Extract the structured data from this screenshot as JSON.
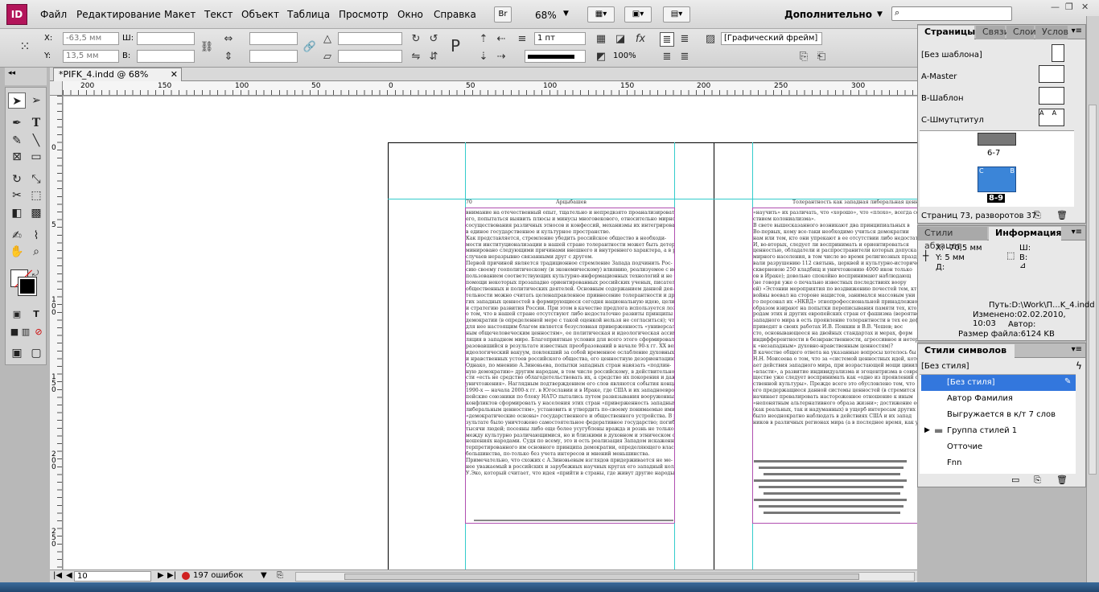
{
  "app": {
    "logo": "ID",
    "menu": [
      "Файл",
      "Редактирование",
      "Макет",
      "Текст",
      "Объект",
      "Таблица",
      "Просмотр",
      "Окно",
      "Справка"
    ],
    "bridge_button": "Br",
    "zoom": "68%",
    "workspace": "Дополнительно"
  },
  "control": {
    "x_label": "X:",
    "x_value": "-63,5 мм",
    "y_label": "Y:",
    "y_value": "13,5 мм",
    "w_label": "Ш:",
    "h_label": "В:",
    "stroke_weight": "1 пт",
    "opacity": "100%",
    "object_style": "[Графический фрейм]"
  },
  "document": {
    "tab_title": "*PIFK_4.indd @ 68%",
    "ruler_h": [
      "200",
      "150",
      "100",
      "50",
      "0",
      "50",
      "100",
      "150",
      "200",
      "250",
      "300"
    ],
    "ruler_v": [
      "0",
      "5",
      "1\n0\n0",
      "1\n5\n0",
      "2\n0\n0",
      "2\n5\n0"
    ],
    "left_header_num": "70",
    "left_header_title": "Арцыбашев",
    "right_header_title": "Толерантность как западная либеральная ценность"
  },
  "status": {
    "page": "10",
    "errors": "197 ошибок"
  },
  "pages_panel": {
    "tabs": [
      "Страницы",
      "Связи",
      "Слои",
      "Услов"
    ],
    "masters": [
      "[Без шаблона]",
      "A-Master",
      "B-Шаблон",
      "C-Шмутцтитул"
    ],
    "spread_a": "6-7",
    "spread_b": "8-9",
    "footer": "Страниц 73, разворотов 37"
  },
  "info_panel": {
    "tabs": [
      "Стили абзацев",
      "Информация"
    ],
    "x": "X: -70,5 мм",
    "y": "Y: 5 мм",
    "d": "Д:",
    "w": "Ш:",
    "h": "В:",
    "path": "Путь:D:\\Work\\П...K_4.indd",
    "modified": "Изменено:02.02.2010, 10:03",
    "author": "Автор:",
    "size": "Размер файла:6124 KB"
  },
  "char_styles": {
    "title": "Стили символов",
    "current": "[Без стиля]",
    "items": [
      "[Без стиля]",
      "Автор Фамилия",
      "Выгружается в к/т 7 слов",
      "Группа стилей 1",
      "Отточие",
      "Fnn"
    ]
  },
  "left_text": [
    "внимание на отечественный опыт, тщательно и непредвзято проанализировать",
    "его, попытаться выявить плюсы и минусы многовекового, относительно мирного",
    "сосуществования различных этносов и конфессий, механизмы их интегрирования",
    "в единое государственное и культурное пространство.",
    "Как представляется, стремление убедить российское общество в необходи-",
    "мости институционализации в нашей стране толерантности может быть детер-",
    "минировано следующими причинами внешнего и внутреннего характера, а в ряде",
    "случаев неразрывно связанными друг с другом.",
    "Первой причиной является традиционное стремление Запада подчинить Рос-",
    "сию своему геополитическому (и экономическому) влиянию, реализуемое с ис-",
    "пользованием соответствующих культурно-информационных технологий и не без",
    "помощи некоторых прозападно ориентированных российских ученых, писателей,",
    "общественных и политических деятелей. Основным содержанием данной дея-",
    "тельности можно считать целенаправленное привнесение толерантности и дру-",
    "гих западных ценностей в формирующиеся сегодня национальную идею, цели",
    "и стратегию развития России. При этом в качестве предлога используется лозунг",
    "о том, что в нашей стране отсутствуют либо недостаточно развиты принципы",
    "демократии (в определенной мере с такой оценкой нельзя не согласиться); что",
    "для нее настоящим благом является безусловная приверженность «универсаль-",
    "ным общечеловеческим ценностям», ее политическая и идеологическая ассими-",
    "ляция в западном мире. Благоприятные условия для всего этого сформировал об-",
    "разовавшийся в результате известных преобразований в начале 90-х гг. XX века",
    "идеологический вакуум, повлекший за собой временное ослабление духовных",
    "и нравственных устоев российского общества, его ценностную дезориентацию.",
    "Однако, по мнению А.Зиновьева, попытки западных стран навязать «подлин-",
    "ную демократию» другим народам, в том числе российскому, в действительно-",
    "сти «есть не средство облагодетельствовать их, а средство их покорения и даже",
    "уничтожения». Наглядным подтверждением его слов являются события конца",
    "1990-х — начала 2000-х гг. в Югославии и в Ираке, где США и их западноевро-",
    "пейские союзники по блоку НАТО пытались путем развязывания вооруженных",
    "конфликтов сформировать у населения этих стран «приверженность западным",
    "либеральным ценностям», установить и утвердить по-своему понимаемые ими",
    "«демократические основы» государственного и общественного устройства. В ре-",
    "зультате было уничтожено самостоятельное федеративное государство; погибли",
    "тысячи людей; посеяны либо еще более усугублены вражда и рознь не только",
    "между культурно различающимися, но и близкими в духовном и этническом от-",
    "ношениях народами. Судя по всему, это и есть реализация Западом искаженно ин-",
    "терпретированного им основного принципа демократии, определяющего власть",
    "большинства, по-только без учета интересов и мнений меньшинства.",
    "Примечательно, что схожих с А.Зиновьевым взглядов придерживается не ме-",
    "нее уважаемый в российских и зарубежных научных кругах его западный коллега",
    "У.Эко, который считает, что идея «прийти в страны, где живут другие народы,"
  ],
  "right_text": [
    "«научить» их различать, что «хорошо», что «плохо», всегда со-",
    "ствием колониализма».",
    "В свете вышесказанного возникают два принципиальных в",
    "Во-первых, кому все-таки необходимо учиться демократии",
    "нам или тем, кто они упрекают в ее отсутствии либо недостат",
    "И, во-вторых, следует ли воспринимать и ориентироваться",
    "ценностью, обладатели и распространители которых допуска",
    "мирного населения, в том числе во время религиозных празд",
    "вали разрушению 112 святынь, церквей и культурно-историче",
    "скверненою 250 кладбищ и уничтожению 4000 икон только",
    "ов в Ираке); довольно спокойно воспринимают наблюдающ",
    "(не говоря уже о печально известных последствиях воору",
    "ей) «Эстонии мероприятия по воздвижению почестей тем, кто в",
    "войны воевал на стороне нацистов, занимался массовым уни",
    "го персонал их «НКВД» этнопрофессиональной принадлежнос",
    "образом взирают на попытки переписывания памяти тех, кто принес",
    "родам этих и других европейских стран от фашизма (вероятно",
    "западного мира в есть проявление толерантности в тех ее деф",
    "приводят в своих работах И.В. Понкин и В.В. Чешев; вос",
    "сто, основывающееся на двойных стандартах и мерах, форм",
    "индифферентности в безнравственности, агрессивное и нетерпимо",
    "к «незападным» духовно-нравственным ценностям)?",
    "В качестве общего ответа на указанные вопросы хотелось бы",
    "Н.Н. Моисеева о том, что за «системой ценностных идей, котор",
    "ает действия западного мира, при возрастающей мощи цивили",
    "«власти», а развитие индивидуализма и эгоцентризма в соврем",
    "ществе уже следует воспринимать как «одно из проявлений об",
    "ственной культуры». Прежде всего это обусловлено тем, что",
    "его предержащиеся данной системы ценностей (в стремится на",
    "начинает превалировать настороженное отношение к иным",
    "«непонятным альтернативного образа жизни»; достижение ее",
    "(как реальных, так и надуманных) в ущерб интересам других",
    "было неоднократно наблюдать в действиях США и их запад",
    "ников в различных регионах мира (а в последнее время, как у"
  ]
}
